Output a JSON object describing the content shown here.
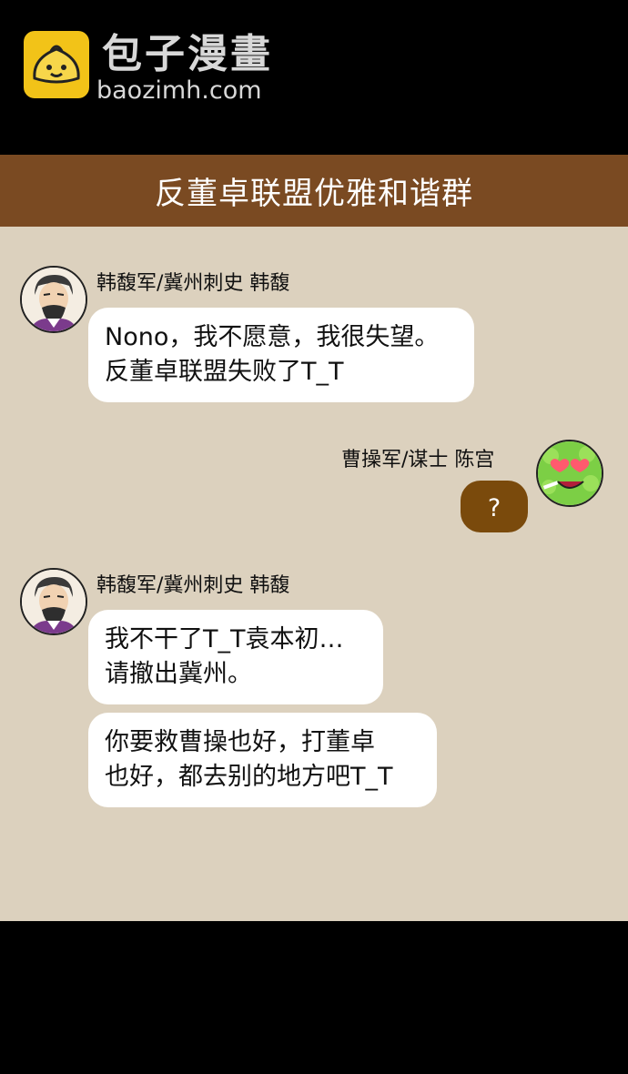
{
  "watermark": {
    "title": "包子漫畫",
    "url": "baozimh.com"
  },
  "group": {
    "title": "反董卓联盟优雅和谐群"
  },
  "messages": [
    {
      "sender": "韩馥军/冀州刺史 韩馥",
      "side": "left",
      "bubbles": [
        {
          "lines": [
            "Nono，我不愿意，我很失望。",
            "反董卓联盟失败了T_T"
          ]
        }
      ]
    },
    {
      "sender": "曹操军/谋士 陈宫",
      "side": "right",
      "bubbles": [
        {
          "lines": [
            "?"
          ]
        }
      ]
    },
    {
      "sender": "韩馥军/冀州刺史 韩馥",
      "side": "left",
      "bubbles": [
        {
          "lines": [
            "我不干了T_T袁本初…",
            "请撤出冀州。"
          ]
        },
        {
          "lines": [
            "你要救曹操也好，打董卓",
            "也好，都去别的地方吧T_T"
          ]
        }
      ]
    }
  ],
  "colors": {
    "title_bar": "#7a4a22",
    "chat_background": "#dcd1be",
    "own_bubble": "#7a4a0c",
    "logo": "#f2c318"
  },
  "icons": {
    "logo": "steamed-bun-icon",
    "avatar_han_fu": "bearded-man-avatar",
    "avatar_chen_gong": "green-heart-eyes-face-avatar"
  }
}
